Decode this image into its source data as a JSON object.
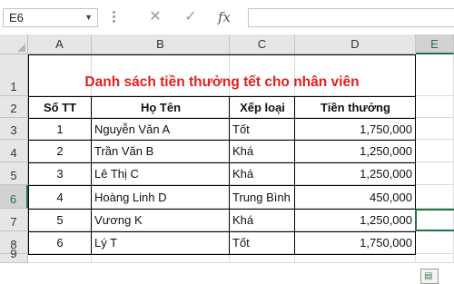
{
  "formula_bar": {
    "name_box": "E6",
    "cancel_icon": "close-icon",
    "enter_icon": "check-icon",
    "function_label": "fx",
    "formula": ""
  },
  "columns": [
    "A",
    "B",
    "C",
    "D",
    "E"
  ],
  "rows": [
    "1",
    "2",
    "3",
    "4",
    "5",
    "6",
    "7",
    "8",
    "9"
  ],
  "selected_cell": "E6",
  "accent_color": "#217346",
  "title_color": "#e02020",
  "sheet": {
    "title": "Danh sách tiền thưởng tết cho nhân viên",
    "headers": [
      "Số TT",
      "Họ Tên",
      "Xếp loại",
      "Tiền thưởng"
    ],
    "rows": [
      {
        "stt": "1",
        "name": "Nguyễn Văn A",
        "rank": "Tốt",
        "bonus": "1,750,000"
      },
      {
        "stt": "2",
        "name": "Trần Văn B",
        "rank": "Khá",
        "bonus": "1,250,000"
      },
      {
        "stt": "3",
        "name": "Lê Thị C",
        "rank": "Khá",
        "bonus": "1,250,000"
      },
      {
        "stt": "4",
        "name": "Hoàng Linh D",
        "rank": "Trung Bình",
        "bonus": "450,000"
      },
      {
        "stt": "5",
        "name": "Vương K",
        "rank": "Khá",
        "bonus": "1,250,000"
      },
      {
        "stt": "6",
        "name": "Lý T",
        "rank": "Tốt",
        "bonus": "1,750,000"
      }
    ]
  }
}
